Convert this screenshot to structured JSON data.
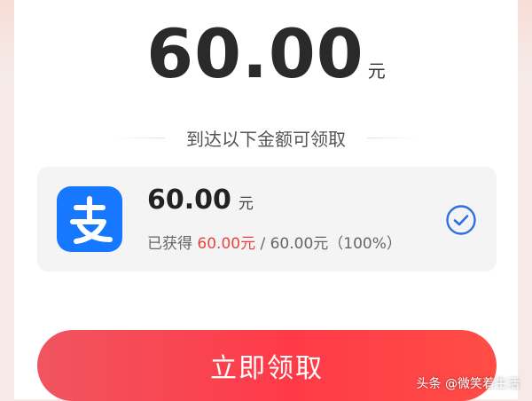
{
  "header": {
    "amount": "60.00",
    "unit": "元"
  },
  "section": {
    "label": "到达以下金额可领取"
  },
  "reward": {
    "app_icon": "alipay-icon",
    "amount": "60.00",
    "unit": "元",
    "progress_prefix": "已获得",
    "progress_current": "60.00元",
    "progress_rest": " / 60.00元（100%）",
    "progress_fraction": 1.0,
    "status_icon": "check-circle-icon"
  },
  "actions": {
    "claim_label": "立即领取"
  },
  "watermark": {
    "text": "头条 @微笑着生活"
  },
  "colors": {
    "accent_red": "#ff3a48",
    "highlight_red": "#e8443f",
    "alipay_blue": "#1677ff",
    "check_blue": "#2b6fe0"
  }
}
